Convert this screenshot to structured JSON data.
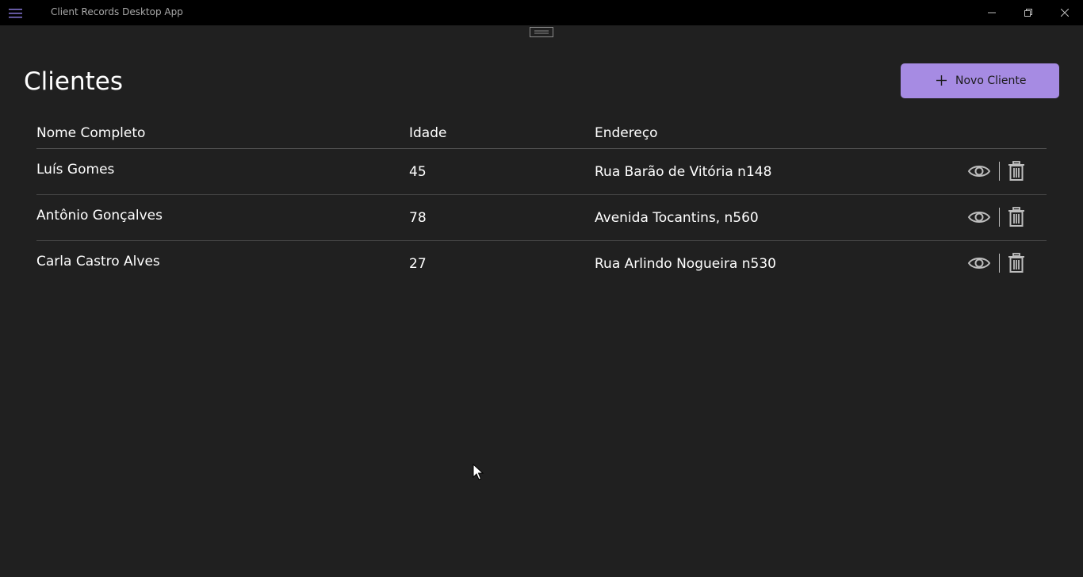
{
  "window": {
    "title": "Client Records Desktop App",
    "menu_icon": "hamburger-icon",
    "controls": [
      "minimize-icon",
      "maximize-icon",
      "close-icon"
    ]
  },
  "page": {
    "title": "Clientes",
    "new_button": {
      "label": "Novo Cliente",
      "icon": "plus-icon",
      "color": "#a68be3"
    }
  },
  "table": {
    "headers": {
      "name": "Nome Completo",
      "age": "Idade",
      "address": "Endereço"
    },
    "rows": [
      {
        "name": "Luís Gomes",
        "age": "45",
        "address": "Rua Barão de Vitória n148"
      },
      {
        "name": "Antônio Gonçalves",
        "age": "78",
        "address": "Avenida Tocantins, n560"
      },
      {
        "name": "Carla Castro Alves",
        "age": "27",
        "address": "Rua Arlindo Nogueira n530"
      }
    ],
    "row_actions": [
      "eye-icon",
      "trash-icon"
    ]
  },
  "colors": {
    "background": "#202020",
    "titlebar": "#000000",
    "accent": "#a68be3",
    "menu_icon": "#8f7fe8"
  }
}
